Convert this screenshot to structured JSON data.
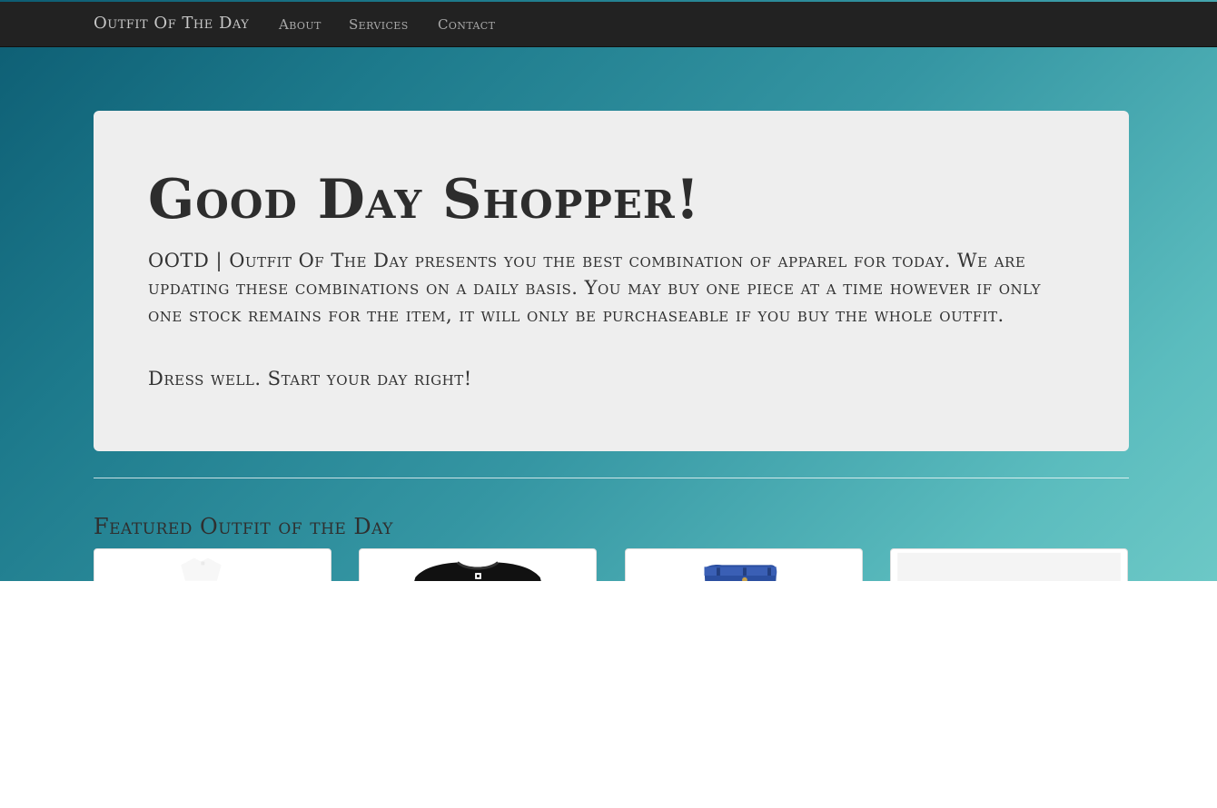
{
  "navbar": {
    "brand": "Outfit Of The Day",
    "links": [
      "About",
      "Services",
      "Contact"
    ]
  },
  "hero": {
    "title": "Good Day Shopper!",
    "description": "OOTD | Outfit Of The Day presents you the best combination of apparel for today. We are updating these combinations on a daily basis. You may buy one piece at a time however if only one stock remains for the item, it will only be purchaseable if you buy the whole outfit.",
    "tagline": "Dress well. Start your day right!"
  },
  "featured": {
    "title": "Featured Outfit of the Day",
    "products": [
      {
        "icon": "white-shirt-image"
      },
      {
        "icon": "black-tshirt-image"
      },
      {
        "icon": "denim-shorts-image"
      },
      {
        "icon": "placeholder-image"
      }
    ]
  },
  "colors": {
    "navbar_bg": "#222222",
    "jumbotron_bg": "#eeeeee",
    "background_gradient_start": "#0d5d73",
    "background_gradient_end": "#6cc8c6"
  }
}
